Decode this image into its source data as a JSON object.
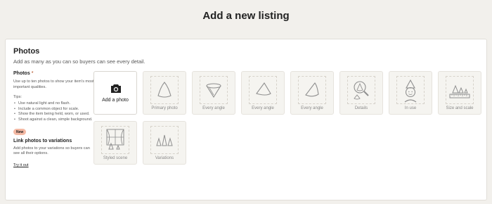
{
  "page": {
    "title": "Add a new listing"
  },
  "photos_section": {
    "title": "Photos",
    "subtitle": "Add as many as you can so buyers can see every detail."
  },
  "left_column": {
    "photos_label": "Photos",
    "required_mark": "*",
    "description": "Use up to ten photos to show your item's most important qualities.",
    "tips_label": "Tips:",
    "tips": [
      "Use natural light and no flash.",
      "Include a common object for scale.",
      "Show the item being held, worn, or used.",
      "Shoot against a clean, simple background."
    ],
    "new_badge": "New",
    "link_title": "Link photos to variations",
    "link_description": "Add photos to your variations so buyers can see all their options.",
    "try_link": "Try it out"
  },
  "add_photo": {
    "label": "Add a photo",
    "icon": "camera-icon"
  },
  "slots": [
    {
      "label": "Primary photo",
      "icon": "cone-icon"
    },
    {
      "label": "Every angle",
      "icon": "cone-top-icon"
    },
    {
      "label": "Every angle",
      "icon": "cone-side-icon"
    },
    {
      "label": "Every angle",
      "icon": "cone-back-icon"
    },
    {
      "label": "Details",
      "icon": "magnifier-icon"
    },
    {
      "label": "In use",
      "icon": "person-icon"
    },
    {
      "label": "Size and scale",
      "icon": "ruler-icon"
    },
    {
      "label": "Styled scene",
      "icon": "window-scene-icon"
    },
    {
      "label": "Variations",
      "icon": "variations-icon"
    }
  ],
  "colors": {
    "background": "#f2f0ec",
    "card": "#ffffff",
    "tile": "#f5f4f0",
    "badge": "#f4b9a4",
    "illustration": "#8f8f8f"
  }
}
